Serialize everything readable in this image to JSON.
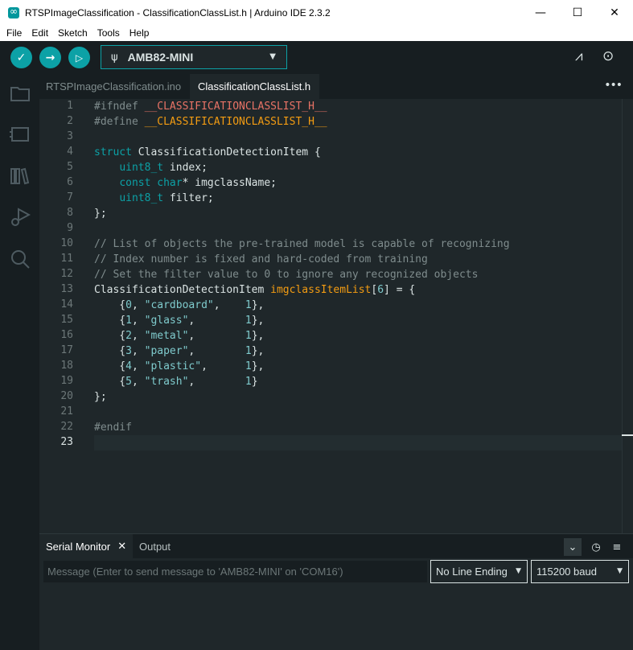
{
  "window": {
    "title": "RTSPImageClassification - ClassificationClassList.h | Arduino IDE 2.3.2",
    "app_icon": "arduino-icon",
    "controls": {
      "minimize": "—",
      "maximize": "☐",
      "close": "✕"
    }
  },
  "menu": {
    "items": [
      "File",
      "Edit",
      "Sketch",
      "Tools",
      "Help"
    ]
  },
  "toolbar": {
    "verify_icon": "✓",
    "upload_icon": "→",
    "debug_icon": "▷",
    "board": {
      "usb_icon": "ψ",
      "name": "AMB82-MINI",
      "caret": "▼"
    },
    "plotter_icon": "⩘",
    "monitor_icon": "⊙"
  },
  "sidebar": {
    "icons": [
      "folder-icon",
      "board-manager-icon",
      "library-icon",
      "debug-icon",
      "search-icon"
    ]
  },
  "tabs": [
    {
      "label": "RTSPImageClassification.ino",
      "active": false
    },
    {
      "label": "ClassificationClassList.h",
      "active": true
    }
  ],
  "tabs_more": "•••",
  "editor": {
    "line_numbers": [
      "1",
      "2",
      "3",
      "4",
      "5",
      "6",
      "7",
      "8",
      "9",
      "10",
      "11",
      "12",
      "13",
      "14",
      "15",
      "16",
      "17",
      "18",
      "19",
      "20",
      "21",
      "22",
      "23"
    ],
    "current_line": "23"
  },
  "serial_monitor": {
    "tab_label": "Serial Monitor",
    "close_icon": "✕",
    "output_tab_label": "Output",
    "autoscroll_icon": "⌄",
    "timestamp_icon": "◷",
    "clear_icon": "≡",
    "message_placeholder": "Message (Enter to send message to 'AMB82-MINI' on 'COM16')",
    "line_ending": "No Line Ending",
    "baud": "115200 baud",
    "caret": "▼"
  },
  "colors": {
    "accent": "#0ca1a6",
    "background": "#1f272a",
    "sidebar": "#171e21"
  }
}
